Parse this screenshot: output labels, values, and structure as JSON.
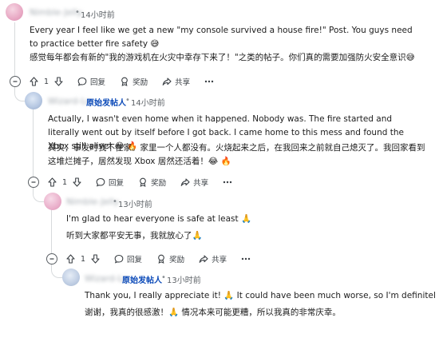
{
  "comments": [
    {
      "username": "Nimble-Jelly",
      "time": "14小时前",
      "text_en": "Every year I feel like we get a new \"my console survived a house fire!\" Post. You guys need to practice better fire safety 😅",
      "text_zh": "感觉每年都会有新的\"我的游戏机在火灾中幸存下来了！\"之类的帖子。你们真的需要加强防火安全意识😅",
      "votes": "1",
      "reply": "回复",
      "award": "奖励",
      "share": "共享"
    },
    {
      "username": "Wizard-Lo",
      "op_label": "原始发帖人",
      "time": "14小时前",
      "text_en": "Actually, I wasn't even home when it happened. Nobody was. The fire started and literally went out by itself before I got back. I came home to this mess and found the Xbox still alive! 😂 🔥",
      "text_zh": "其实，事发时我不在家。家里一个人都没有。火烧起来之后，在我回来之前就自己熄灭了。我回家看到这堆烂摊子，居然发现 Xbox 居然还活着！😂 🔥",
      "votes": "1",
      "reply": "回复",
      "award": "奖励",
      "share": "共享"
    },
    {
      "username": "Nimble-Jelly",
      "time": "13小时前",
      "text_en": "I'm glad to hear everyone is safe at least 🙏",
      "text_zh": "听到大家都平安无事，我就放心了🙏",
      "votes": "1",
      "reply": "回复",
      "award": "奖励",
      "share": "共享"
    },
    {
      "username": "Wizard-Lo",
      "op_label": "原始发帖人",
      "time": "13小时前",
      "text_en": "Thank you, I really appreciate it! 🙏 It could have been much worse, so I'm definitely thankful",
      "text_zh": "谢谢，我真的很感激！🙏 情况本来可能更糟，所以我真的非常庆幸。"
    }
  ],
  "separator": "•",
  "colors": {
    "op": "#0a49b8",
    "thread_line": "#d7dadc",
    "text": "#1c1c1c",
    "meta": "#5c6166"
  },
  "icons": [
    "upvote-icon",
    "downvote-icon",
    "reply-icon",
    "award-icon",
    "share-icon",
    "more-icon",
    "collapse-icon"
  ]
}
